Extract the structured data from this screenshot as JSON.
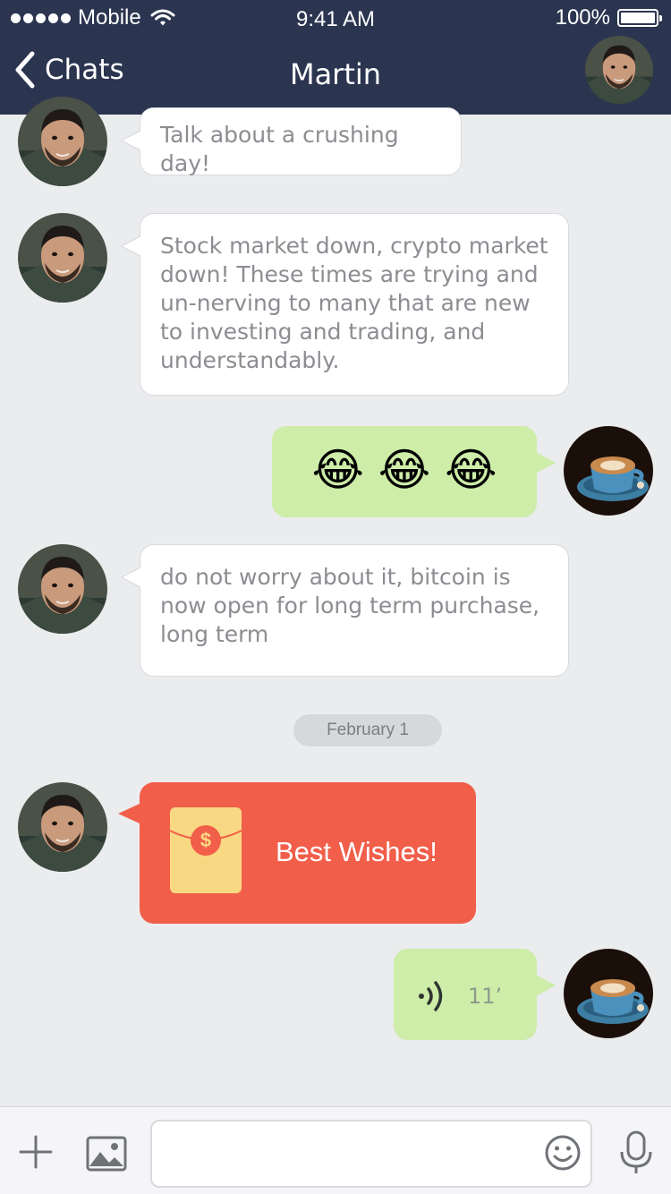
{
  "status_bar": {
    "carrier": "Mobile",
    "time": "9:41 AM",
    "battery": "100%"
  },
  "nav": {
    "back_label": "Chats",
    "title": "Martin"
  },
  "messages": [
    {
      "from": "martin",
      "text": "Talk about a crushing day!"
    },
    {
      "from": "martin",
      "text": "Stock market down, crypto market down! These times are trying and un-nerving to many that are new to investing and trading, and understandably."
    },
    {
      "from": "me",
      "text": "😂 😂 😂"
    },
    {
      "from": "martin",
      "text": "do not worry about it, bitcoin is now open for long term purchase, long term"
    }
  ],
  "date_divider": "February 1",
  "red_envelope": {
    "from": "martin",
    "label": "Best Wishes!",
    "symbol": "$"
  },
  "voice_message": {
    "from": "me",
    "duration": "11’"
  },
  "input_bar": {
    "placeholder": "",
    "icons": [
      "plus-icon",
      "image-icon",
      "emoji-icon",
      "microphone-icon"
    ]
  },
  "colors": {
    "header": "#2b3550",
    "background": "#ebecee",
    "outgoing_bubble": "#cdeda9",
    "red_envelope": "#f15e4a",
    "envelope_paper": "#f9d883"
  }
}
